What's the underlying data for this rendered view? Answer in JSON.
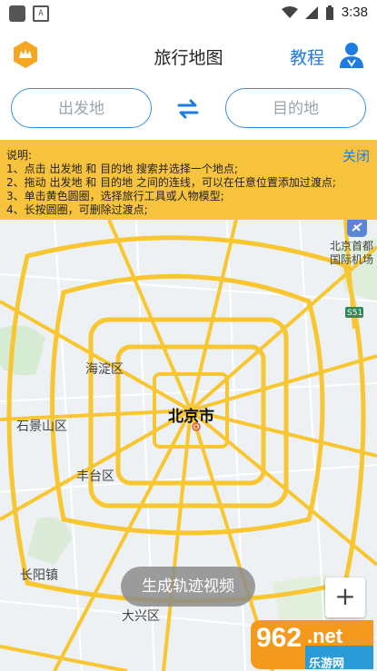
{
  "status_bar": {
    "time": "3:38",
    "left_badge": "A"
  },
  "app_bar": {
    "title": "旅行地图",
    "tutorial": "教程"
  },
  "route": {
    "from_placeholder": "出发地",
    "to_placeholder": "目的地"
  },
  "notice": {
    "title": "说明:",
    "lines": [
      "1、点击 出发地 和 目的地 搜索并选择一个地点;",
      "2、拖动 出发地 和 目的地 之间的连线，可以在任意位置添加过渡点;",
      "3、单击黄色圆圈，选择旅行工具或人物模型;",
      "4、长按圆圈，可删除过渡点;"
    ],
    "close": "关闭"
  },
  "map": {
    "labels": {
      "city": "北京市",
      "haidian": "海淀区",
      "shijingshan": "石景山区",
      "fengtai": "丰台区",
      "changyang": "长阳镇",
      "daxing": "大兴区",
      "airport_line1": "北京首都",
      "airport_line2": "国际机场",
      "highway": "S51"
    },
    "road_color": "#f7c631",
    "background": "#eef1f3"
  },
  "controls": {
    "generate_video": "生成轨迹视频",
    "zoom_in": "+"
  },
  "watermark": {
    "number": "962",
    "net": ".net",
    "text": "乐游网"
  }
}
